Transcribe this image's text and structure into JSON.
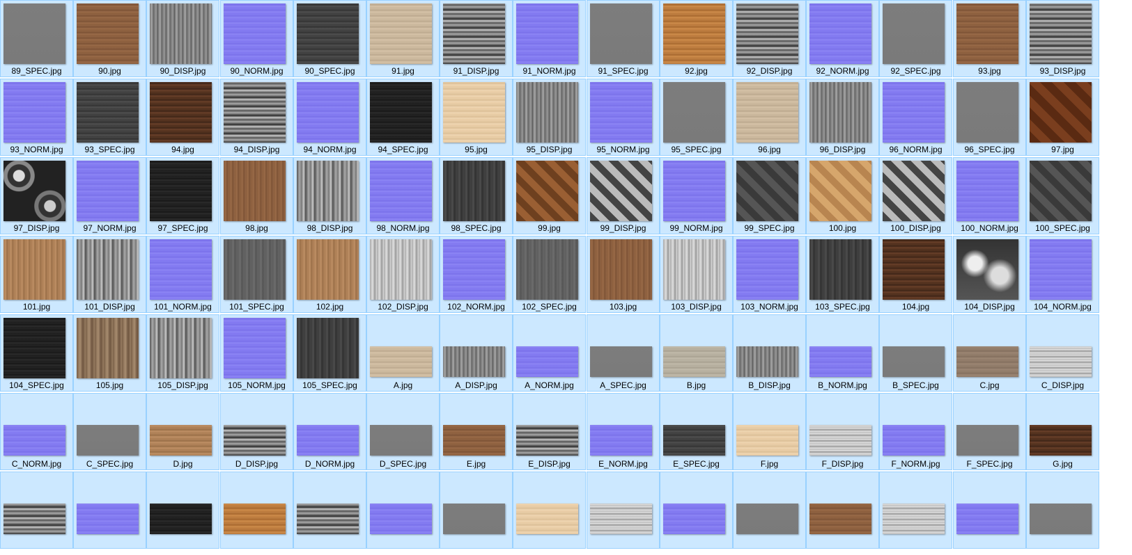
{
  "view": "large-icons",
  "tiles": [
    {
      "name": "89_SPEC.jpg",
      "kind": "spec",
      "shape": "square"
    },
    {
      "name": "90.jpg",
      "kind": "wood-brown",
      "shape": "square"
    },
    {
      "name": "90_DISP.jpg",
      "kind": "disp",
      "shape": "square"
    },
    {
      "name": "90_NORM.jpg",
      "kind": "norm",
      "shape": "square"
    },
    {
      "name": "90_SPEC.jpg",
      "kind": "spec-dark",
      "shape": "square"
    },
    {
      "name": "91.jpg",
      "kind": "wood-light",
      "shape": "square"
    },
    {
      "name": "91_DISP.jpg",
      "kind": "disp-strong",
      "shape": "square"
    },
    {
      "name": "91_NORM.jpg",
      "kind": "norm",
      "shape": "square"
    },
    {
      "name": "91_SPEC.jpg",
      "kind": "spec",
      "shape": "square"
    },
    {
      "name": "92.jpg",
      "kind": "wood-orange",
      "shape": "square"
    },
    {
      "name": "92_DISP.jpg",
      "kind": "disp-strong",
      "shape": "square"
    },
    {
      "name": "92_NORM.jpg",
      "kind": "norm",
      "shape": "square"
    },
    {
      "name": "92_SPEC.jpg",
      "kind": "spec",
      "shape": "square"
    },
    {
      "name": "93.jpg",
      "kind": "wood-brown",
      "shape": "square"
    },
    {
      "name": "93_DISP.jpg",
      "kind": "disp-strong",
      "shape": "square"
    },
    {
      "name": "93_NORM.jpg",
      "kind": "norm",
      "shape": "square"
    },
    {
      "name": "93_SPEC.jpg",
      "kind": "spec-dark",
      "shape": "square"
    },
    {
      "name": "94.jpg",
      "kind": "wood-dark",
      "shape": "square"
    },
    {
      "name": "94_DISP.jpg",
      "kind": "disp-strong",
      "shape": "square"
    },
    {
      "name": "94_NORM.jpg",
      "kind": "norm",
      "shape": "square"
    },
    {
      "name": "94_SPEC.jpg",
      "kind": "spec-black",
      "shape": "square"
    },
    {
      "name": "95.jpg",
      "kind": "wood-pale",
      "shape": "square"
    },
    {
      "name": "95_DISP.jpg",
      "kind": "disp",
      "shape": "square"
    },
    {
      "name": "95_NORM.jpg",
      "kind": "norm",
      "shape": "square"
    },
    {
      "name": "95_SPEC.jpg",
      "kind": "spec",
      "shape": "square"
    },
    {
      "name": "96.jpg",
      "kind": "wood-light",
      "shape": "square"
    },
    {
      "name": "96_DISP.jpg",
      "kind": "disp",
      "shape": "square"
    },
    {
      "name": "96_NORM.jpg",
      "kind": "norm",
      "shape": "square"
    },
    {
      "name": "96_SPEC.jpg",
      "kind": "spec",
      "shape": "square"
    },
    {
      "name": "97.jpg",
      "kind": "wood-parquet",
      "shape": "square"
    },
    {
      "name": "97_DISP.jpg",
      "kind": "disp-pattern",
      "shape": "square"
    },
    {
      "name": "97_NORM.jpg",
      "kind": "norm",
      "shape": "square"
    },
    {
      "name": "97_SPEC.jpg",
      "kind": "spec-black",
      "shape": "square"
    },
    {
      "name": "98.jpg",
      "kind": "wood-brown-v",
      "shape": "square"
    },
    {
      "name": "98_DISP.jpg",
      "kind": "disp-v",
      "shape": "square"
    },
    {
      "name": "98_NORM.jpg",
      "kind": "norm",
      "shape": "square"
    },
    {
      "name": "98_SPEC.jpg",
      "kind": "spec-dark-v",
      "shape": "square"
    },
    {
      "name": "99.jpg",
      "kind": "wood-herringbone",
      "shape": "square"
    },
    {
      "name": "99_DISP.jpg",
      "kind": "disp-herringbone",
      "shape": "square"
    },
    {
      "name": "99_NORM.jpg",
      "kind": "norm",
      "shape": "square"
    },
    {
      "name": "99_SPEC.jpg",
      "kind": "spec-herringbone",
      "shape": "square"
    },
    {
      "name": "100.jpg",
      "kind": "wood-herringbone-light",
      "shape": "square"
    },
    {
      "name": "100_DISP.jpg",
      "kind": "disp-herringbone",
      "shape": "square"
    },
    {
      "name": "100_NORM.jpg",
      "kind": "norm",
      "shape": "square"
    },
    {
      "name": "100_SPEC.jpg",
      "kind": "spec-herringbone",
      "shape": "square"
    },
    {
      "name": "101.jpg",
      "kind": "wood-tan-v",
      "shape": "square"
    },
    {
      "name": "101_DISP.jpg",
      "kind": "disp-v",
      "shape": "square"
    },
    {
      "name": "101_NORM.jpg",
      "kind": "norm",
      "shape": "square"
    },
    {
      "name": "101_SPEC.jpg",
      "kind": "spec-v",
      "shape": "square"
    },
    {
      "name": "102.jpg",
      "kind": "wood-tan-v",
      "shape": "square"
    },
    {
      "name": "102_DISP.jpg",
      "kind": "disp-v-light",
      "shape": "square"
    },
    {
      "name": "102_NORM.jpg",
      "kind": "norm",
      "shape": "square"
    },
    {
      "name": "102_SPEC.jpg",
      "kind": "spec-v",
      "shape": "square"
    },
    {
      "name": "103.jpg",
      "kind": "wood-brown-v",
      "shape": "square"
    },
    {
      "name": "103_DISP.jpg",
      "kind": "disp-v-light",
      "shape": "square"
    },
    {
      "name": "103_NORM.jpg",
      "kind": "norm",
      "shape": "square"
    },
    {
      "name": "103_SPEC.jpg",
      "kind": "spec-dark-v",
      "shape": "square"
    },
    {
      "name": "104.jpg",
      "kind": "wood-dark",
      "shape": "square"
    },
    {
      "name": "104_DISP.jpg",
      "kind": "disp-cloud",
      "shape": "square"
    },
    {
      "name": "104_NORM.jpg",
      "kind": "norm",
      "shape": "square"
    },
    {
      "name": "104_SPEC.jpg",
      "kind": "spec-black",
      "shape": "square"
    },
    {
      "name": "105.jpg",
      "kind": "wood-plank-v",
      "shape": "square"
    },
    {
      "name": "105_DISP.jpg",
      "kind": "disp-v",
      "shape": "square"
    },
    {
      "name": "105_NORM.jpg",
      "kind": "norm",
      "shape": "square"
    },
    {
      "name": "105_SPEC.jpg",
      "kind": "spec-dark-v",
      "shape": "square"
    },
    {
      "name": "A.jpg",
      "kind": "wood-light",
      "shape": "wide"
    },
    {
      "name": "A_DISP.jpg",
      "kind": "disp",
      "shape": "wide"
    },
    {
      "name": "A_NORM.jpg",
      "kind": "norm",
      "shape": "wide"
    },
    {
      "name": "A_SPEC.jpg",
      "kind": "spec",
      "shape": "wide"
    },
    {
      "name": "B.jpg",
      "kind": "wood-grey",
      "shape": "wide"
    },
    {
      "name": "B_DISP.jpg",
      "kind": "disp",
      "shape": "wide"
    },
    {
      "name": "B_NORM.jpg",
      "kind": "norm",
      "shape": "wide"
    },
    {
      "name": "B_SPEC.jpg",
      "kind": "spec",
      "shape": "wide"
    },
    {
      "name": "C.jpg",
      "kind": "wood-taupe",
      "shape": "wide"
    },
    {
      "name": "C_DISP.jpg",
      "kind": "disp-light",
      "shape": "wide"
    },
    {
      "name": "C_NORM.jpg",
      "kind": "norm",
      "shape": "wide"
    },
    {
      "name": "C_SPEC.jpg",
      "kind": "spec",
      "shape": "wide"
    },
    {
      "name": "D.jpg",
      "kind": "wood-tan",
      "shape": "wide"
    },
    {
      "name": "D_DISP.jpg",
      "kind": "disp-strong",
      "shape": "wide"
    },
    {
      "name": "D_NORM.jpg",
      "kind": "norm",
      "shape": "wide"
    },
    {
      "name": "D_SPEC.jpg",
      "kind": "spec",
      "shape": "wide"
    },
    {
      "name": "E.jpg",
      "kind": "wood-brown",
      "shape": "wide"
    },
    {
      "name": "E_DISP.jpg",
      "kind": "disp-strong",
      "shape": "wide"
    },
    {
      "name": "E_NORM.jpg",
      "kind": "norm",
      "shape": "wide"
    },
    {
      "name": "E_SPEC.jpg",
      "kind": "spec-dark",
      "shape": "wide"
    },
    {
      "name": "F.jpg",
      "kind": "wood-pale",
      "shape": "wide"
    },
    {
      "name": "F_DISP.jpg",
      "kind": "disp-light",
      "shape": "wide"
    },
    {
      "name": "F_NORM.jpg",
      "kind": "norm",
      "shape": "wide"
    },
    {
      "name": "F_SPEC.jpg",
      "kind": "spec",
      "shape": "wide"
    },
    {
      "name": "G.jpg",
      "kind": "wood-dark",
      "shape": "wide"
    },
    {
      "name": "",
      "kind": "disp-strong",
      "shape": "wide"
    },
    {
      "name": "",
      "kind": "norm",
      "shape": "wide"
    },
    {
      "name": "",
      "kind": "spec-black",
      "shape": "wide"
    },
    {
      "name": "",
      "kind": "wood-orange",
      "shape": "wide"
    },
    {
      "name": "",
      "kind": "disp-strong",
      "shape": "wide"
    },
    {
      "name": "",
      "kind": "norm",
      "shape": "wide"
    },
    {
      "name": "",
      "kind": "spec",
      "shape": "wide"
    },
    {
      "name": "",
      "kind": "wood-pale",
      "shape": "wide"
    },
    {
      "name": "",
      "kind": "disp-light",
      "shape": "wide"
    },
    {
      "name": "",
      "kind": "norm",
      "shape": "wide"
    },
    {
      "name": "",
      "kind": "spec",
      "shape": "wide"
    },
    {
      "name": "",
      "kind": "wood-brown",
      "shape": "wide"
    },
    {
      "name": "",
      "kind": "disp-light",
      "shape": "wide"
    },
    {
      "name": "",
      "kind": "norm",
      "shape": "wide"
    },
    {
      "name": "",
      "kind": "spec",
      "shape": "wide"
    }
  ],
  "colors": {
    "tile_background": "#cce8ff",
    "tile_border": "#99d1ff",
    "normal_map": "#8a7ff0"
  }
}
